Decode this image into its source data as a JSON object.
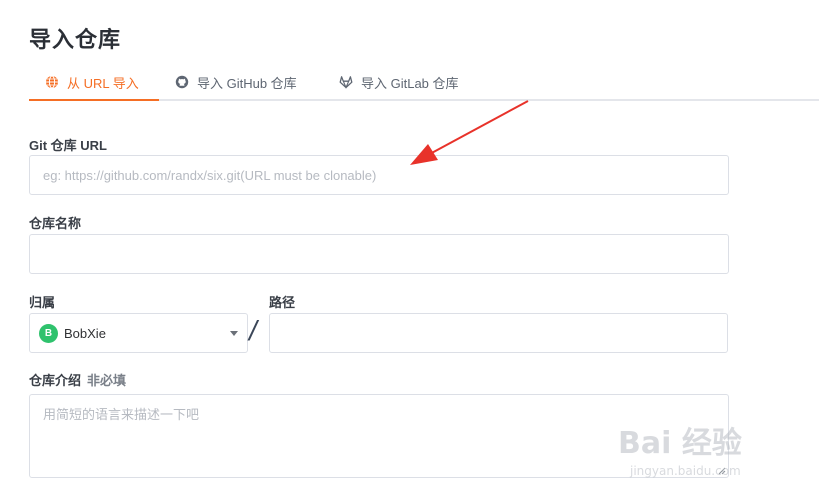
{
  "page": {
    "title": "导入仓库"
  },
  "tabs": [
    {
      "label": "从 URL 导入",
      "icon": "globe-icon",
      "active": true
    },
    {
      "label": "导入 GitHub 仓库",
      "icon": "github-icon",
      "active": false
    },
    {
      "label": "导入 GitLab 仓库",
      "icon": "gitlab-icon",
      "active": false
    }
  ],
  "form": {
    "git_url": {
      "label": "Git 仓库 URL",
      "placeholder": "eg: https://github.com/randx/six.git(URL must be clonable)",
      "value": ""
    },
    "repo_name": {
      "label": "仓库名称",
      "value": ""
    },
    "owner": {
      "label": "归属",
      "avatar_letter": "B",
      "selected": "BobXie",
      "avatar_color": "#2fc26d"
    },
    "separator": "/",
    "path": {
      "label": "路径",
      "value": ""
    },
    "description": {
      "label": "仓库介绍",
      "optional_tag": "非必填",
      "placeholder": "用简短的语言来描述一下吧",
      "value": ""
    }
  },
  "colors": {
    "accent": "#f56e24",
    "annotation_arrow": "#e8322a"
  },
  "watermark": {
    "text": "Bai 经验",
    "url": "jingyan.baidu.com"
  }
}
